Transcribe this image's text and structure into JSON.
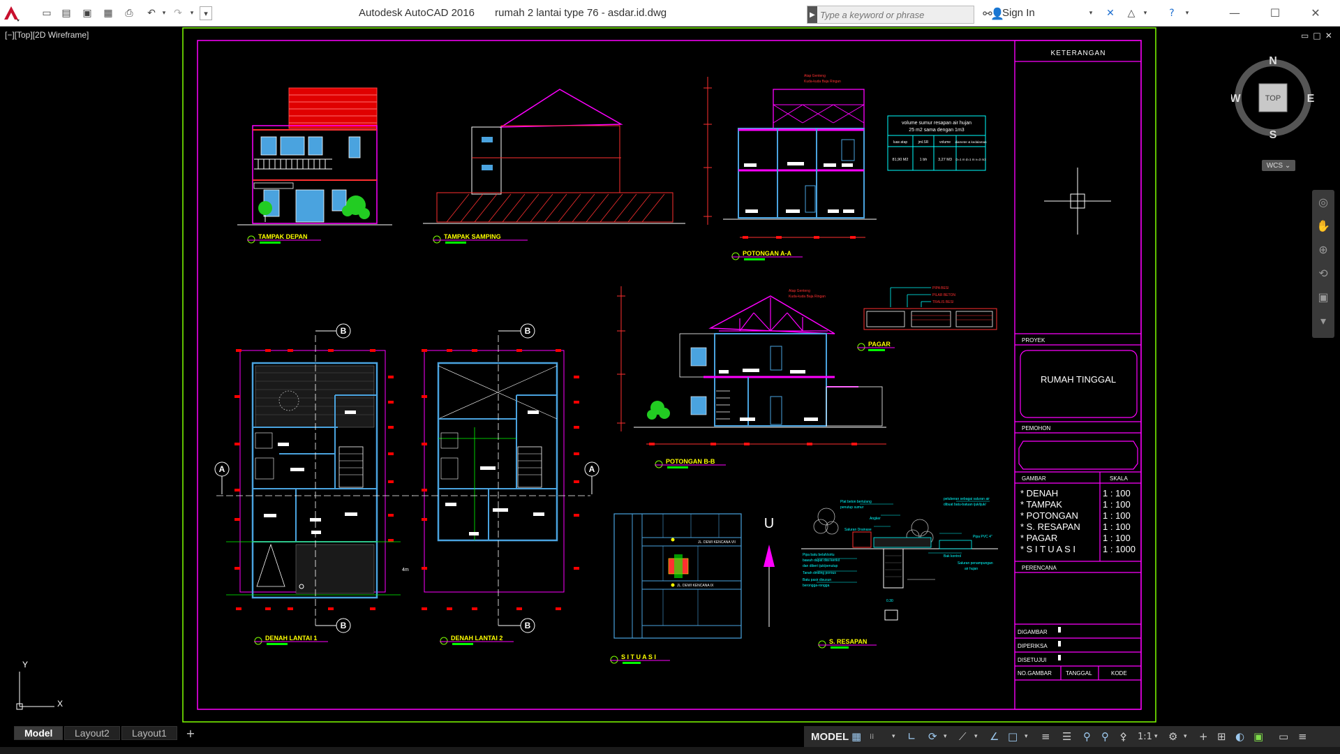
{
  "titlebar": {
    "app_name": "Autodesk AutoCAD 2016",
    "file_name": "rumah 2 lantai type 76 - asdar.id.dwg",
    "search_placeholder": "Type a keyword or phrase",
    "sign_in": "Sign In",
    "quick_access": [
      "new-icon",
      "open-icon",
      "save-icon",
      "save-as-icon",
      "plot-icon",
      "undo-icon",
      "redo-icon",
      "customize-icon"
    ],
    "window_controls": [
      "minimize",
      "maximize",
      "close"
    ]
  },
  "viewport": {
    "label": "[−][Top][2D Wireframe]",
    "controls": [
      "restore-icon",
      "maximize-icon",
      "close-icon"
    ]
  },
  "colors": {
    "border_outer": "#7fff00",
    "border_inner": "#ff00ff",
    "cyan": "#00ffff",
    "blue": "#1e90ff",
    "red": "#ff0000",
    "yellow": "#ffff00",
    "green": "#00ff00",
    "white": "#ffffff",
    "grey": "#808080"
  },
  "title_block": {
    "keterangan": "KETERANGAN",
    "proyek_label": "PROYEK",
    "proyek_value": "RUMAH TINGGAL",
    "pemohon_label": "PEMOHON",
    "gambar_label": "GAMBAR",
    "skala_label": "SKALA",
    "gambar_items": [
      {
        "name": "* DENAH",
        "scale": "1 : 100"
      },
      {
        "name": "* TAMPAK",
        "scale": "1 : 100"
      },
      {
        "name": "* POTONGAN",
        "scale": "1 : 100"
      },
      {
        "name": "* S. RESAPAN",
        "scale": "1 : 100"
      },
      {
        "name": "* PAGAR",
        "scale": "1 : 100"
      },
      {
        "name": "* S I T U A S I",
        "scale": "1 : 1000"
      }
    ],
    "perencana_label": "PERENCANA",
    "digambar": "DIGAMBAR",
    "diperiksa": "DIPERIKSA",
    "disetujui": "DISETUJUI",
    "no_gambar": "NO.GAMBAR",
    "tanggal": "TANGGAL",
    "kode": "KODE"
  },
  "drawing_titles": {
    "tampak_depan": "TAMPAK DEPAN",
    "tampak_samping": "TAMPAK SAMPING",
    "potongan_aa": "POTONGAN A-A",
    "potongan_bb": "POTONGAN B-B",
    "pagar": "PAGAR",
    "denah_1": "DENAH LANTAI 1",
    "denah_2": "DENAH LANTAI 2",
    "situasi": "S I T U A S I",
    "resapan": "S. RESAPAN"
  },
  "resapan_table": {
    "heading_1": "volume sumur resapan air hujan",
    "heading_2": "25 m2 sama dengan 1m3",
    "headers": [
      "luas atap",
      "jml.SR",
      "volume",
      "diameter & kedalaman"
    ],
    "row": [
      "81,90 M2",
      "1 bh",
      "3,27 M3",
      "D=1 m d=1 m v=3 m3"
    ]
  },
  "north_label": "U",
  "section_markers": {
    "a": "A",
    "b": "B"
  },
  "viewcube": {
    "top": "TOP",
    "north": "N",
    "south": "S",
    "east": "E",
    "west": "W",
    "wcs": "WCS"
  },
  "ucs": {
    "x": "X",
    "y": "Y"
  },
  "tabs": [
    "Model",
    "Layout2",
    "Layout1"
  ],
  "status": {
    "model": "MODEL",
    "scale": "1:1"
  }
}
